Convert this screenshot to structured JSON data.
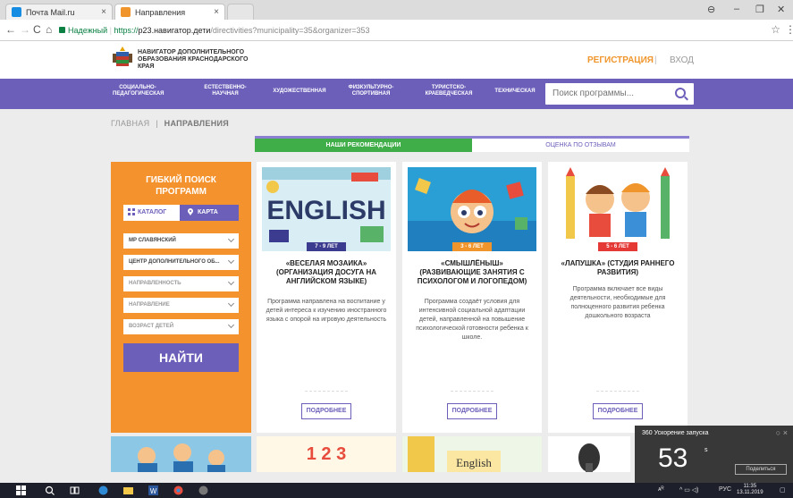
{
  "browser": {
    "tabs": [
      {
        "label": "Почта Mail.ru",
        "favicon_color": "#168de2"
      },
      {
        "label": "Направления",
        "favicon_color": "#f0952b"
      }
    ],
    "url": {
      "secure_label": "Надежный",
      "scheme": "https://",
      "host": "р23.навигатор.дети",
      "path": "/directivities?municipality=35&organizer=353"
    }
  },
  "header": {
    "org_name": "НАВИГАТОР ДОПОЛНИТЕЛЬНОГО ОБРАЗОВАНИЯ КРАСНОДАРСКОГО КРАЯ",
    "register_label": "РЕГИСТРАЦИЯ",
    "separator": "|",
    "login_label": "ВХОД"
  },
  "categories": [
    "СОЦИАЛЬНО-ПЕДАГОГИЧЕСКАЯ",
    "ЕСТЕСТВЕННО-НАУЧНАЯ",
    "ХУДОЖЕСТВЕННАЯ",
    "ФИЗКУЛЬТУРНО-СПОРТИВНАЯ",
    "ТУРИСТСКО-КРАЕВЕДЧЕСКАЯ",
    "ТЕХНИЧЕСКАЯ"
  ],
  "search": {
    "placeholder": "Поиск программы..."
  },
  "breadcrumb": {
    "home": "ГЛАВНАЯ",
    "separator": "|",
    "current": "НАПРАВЛЕНИЯ"
  },
  "rec_tabs": {
    "active": "НАШИ РЕКОМЕНДАЦИИ",
    "inactive": "ОЦЕНКА ПО ОТЗЫВАМ"
  },
  "filter": {
    "title": "ГИБКИЙ ПОИСК ПРОГРАММ",
    "catalog_label": "КАТАЛОГ",
    "map_label": "КАРТА",
    "selects": [
      {
        "value": "МР СЛАВЯНСКИЙ",
        "placeholder": false
      },
      {
        "value": "ЦЕНТР ДОПОЛНИТЕЛЬНОГО ОБ...",
        "placeholder": false
      },
      {
        "value": "НАПРАВЛЕННОСТЬ",
        "placeholder": true
      },
      {
        "value": "НАПРАВЛЕНИЕ",
        "placeholder": true
      },
      {
        "value": "ВОЗРАСТ ДЕТЕЙ",
        "placeholder": true
      }
    ],
    "find_label": "НАЙТИ"
  },
  "cards": [
    {
      "age": "7 - 9 ЛЕТ",
      "age_color": "#3b3b8f",
      "title": "«ВЕСЕЛАЯ МОЗАИКА» (ОРГАНИЗАЦИЯ ДОСУГА НА АНГЛИЙСКОМ ЯЗЫКЕ)",
      "description": "Программа направлена на воспитание у детей интереса к изучению иностранного языка с опорой на игровую деятельность",
      "image_text": "ENGLISH",
      "more_label": "ПОДРОБНЕЕ"
    },
    {
      "age": "3 - 6 ЛЕТ",
      "age_color": "#f0952b",
      "title": "«СМЫШЛЁНЫШ» (РАЗВИВАЮЩИЕ ЗАНЯТИЯ С ПСИХОЛОГОМ И ЛОГОПЕДОМ)",
      "description": "Программа создаёт условия для интенсивной социальной адаптации детей, направленной на повышение психологической готовности ребенка к школе.",
      "image_text": "",
      "more_label": "ПОДРОБНЕЕ"
    },
    {
      "age": "5 - 6 ЛЕТ",
      "age_color": "#e53935",
      "title": "«ЛАПУШКА» (СТУДИЯ РАННЕГО РАЗВИТИЯ)",
      "description": "Программа включает все виды деятельности, необходимые для полноценного развития ребенка дошкольного возраста",
      "image_text": "",
      "more_label": "ПОДРОБНЕЕ"
    }
  ],
  "bottom_cards": [
    {
      "image_text": ""
    },
    {
      "image_text": "1 2 3"
    },
    {
      "image_text": "English"
    },
    {
      "image_text": ""
    }
  ],
  "notification": {
    "title": "360 Ускорение запуска",
    "value": "53",
    "unit": "s",
    "share_label": "Поделиться"
  },
  "taskbar": {
    "lang": "РУС",
    "time": "11:35",
    "date": "13.11.2019"
  },
  "colors": {
    "brand_purple": "#6c5fba",
    "brand_orange": "#f4932e",
    "rec_green": "#3fae49"
  }
}
